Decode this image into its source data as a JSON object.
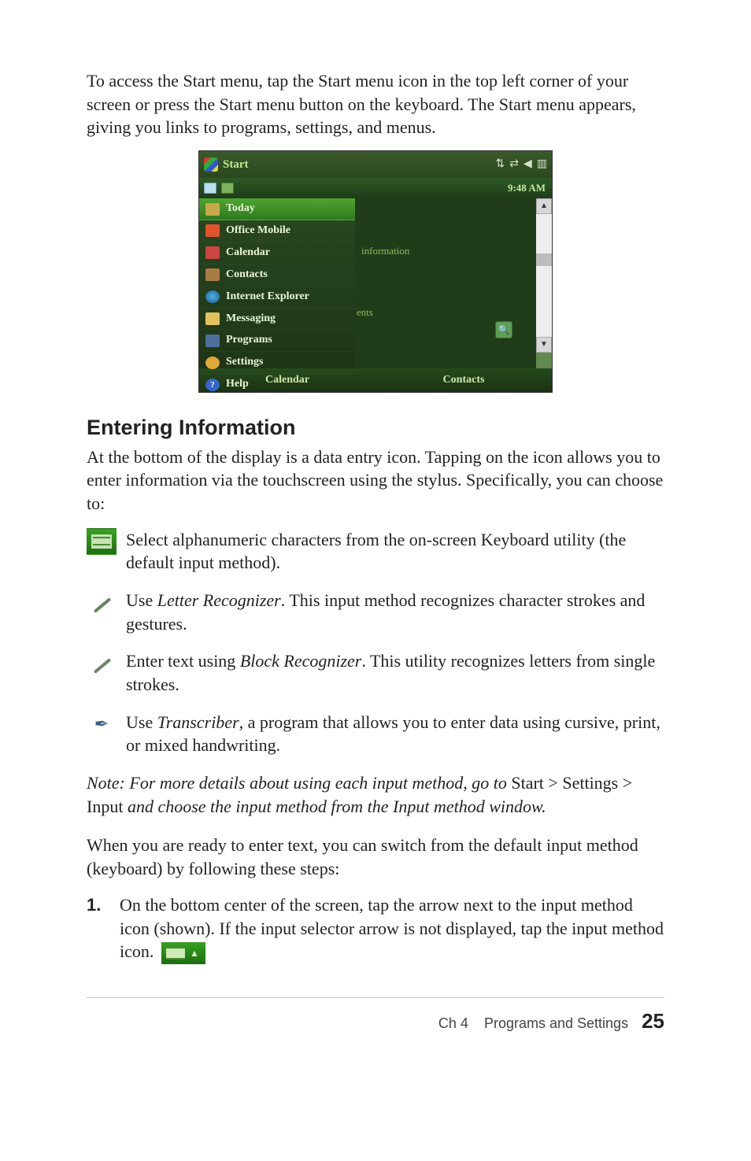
{
  "intro": "To access the Start menu, tap the Start menu icon in the top left corner of your screen or press the Start menu button on the keyboard. The Start menu appears, giving you links to programs, settings, and menus.",
  "screenshot": {
    "title": "Start",
    "time": "9:48 AM",
    "menu": {
      "today": "Today",
      "office": "Office Mobile",
      "calendar": "Calendar",
      "contacts": "Contacts",
      "ie": "Internet Explorer",
      "messaging": "Messaging",
      "programs": "Programs",
      "settings": "Settings",
      "help": "Help"
    },
    "content": {
      "info": "information",
      "ents": "ents"
    },
    "softkeys": {
      "left": "Calendar",
      "right": "Contacts"
    }
  },
  "section_heading": "Entering Information",
  "section_intro": "At the bottom of the display is a data entry icon. Tapping on the icon allows you to enter information via the touchscreen using the stylus. Specifically, you can choose to:",
  "methods": {
    "keyboard": "Select alphanumeric characters from the on-screen Keyboard utility (the default input method).",
    "letter_pre": "Use ",
    "letter_em": "Letter Recognizer",
    "letter_post": ". This input method recognizes character strokes and gestures.",
    "block_pre": "Enter text using ",
    "block_em": "Block Recognizer",
    "block_post": ". This utility recognizes letters from single strokes.",
    "trans_pre": "Use ",
    "trans_em": "Transcriber",
    "trans_post": ", a program that allows you to enter data using cursive, print, or mixed handwriting."
  },
  "note": {
    "pre": "Note:  For more details about using each input method, go to ",
    "start": "Start",
    "gt": " > ",
    "settings": "Settings",
    "input": "Input",
    "mid": " and choose the input method from the Input method window."
  },
  "switch_para": "When you are ready to enter text, you can switch from the default input method (keyboard) by following these steps:",
  "steps": {
    "one_num": "1.",
    "one_text": "On the bottom center of the screen, tap the arrow next to the input method icon (shown). If the input selector arrow is not displayed, tap the input method icon."
  },
  "footer": {
    "chapter": "Ch 4",
    "title": "Programs and Settings",
    "page": "25"
  }
}
